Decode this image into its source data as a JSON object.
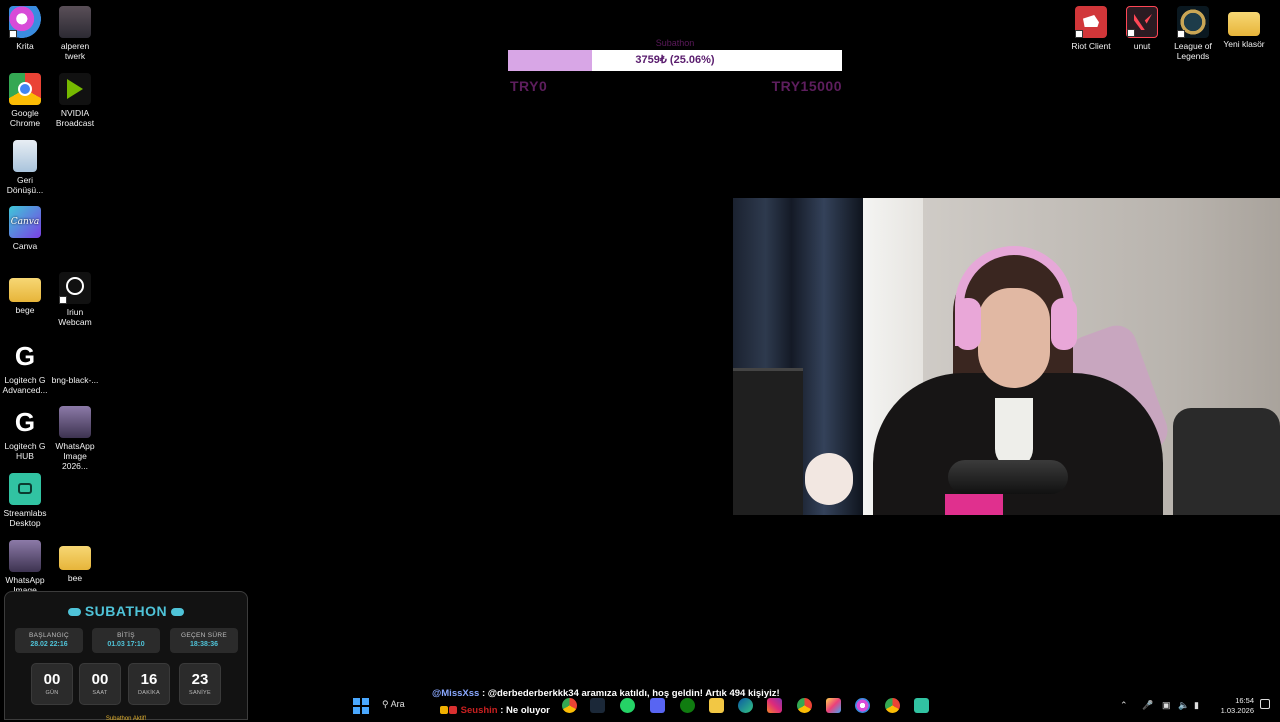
{
  "desktop_icons_left": [
    {
      "label": "Krita",
      "icon": "krita-icon"
    },
    {
      "label": "alperen twerk",
      "icon": "video-thumbnail-icon"
    },
    {
      "label": "Google Chrome",
      "icon": "chrome-icon"
    },
    {
      "label": "NVIDIA Broadcast",
      "icon": "nvidia-icon"
    },
    {
      "label": "Geri Dönüşü...",
      "icon": "recycle-bin-icon"
    },
    {
      "label": "Canva",
      "icon": "canva-icon"
    },
    {
      "label": "bege",
      "icon": "folder-icon"
    },
    {
      "label": "Iriun Webcam",
      "icon": "webcam-icon"
    },
    {
      "label": "Logitech G Advanced...",
      "icon": "logitech-icon"
    },
    {
      "label": "bng-black-...",
      "icon": "image-file-icon"
    },
    {
      "label": "Logitech G HUB",
      "icon": "logitech-icon"
    },
    {
      "label": "WhatsApp Image 2026...",
      "icon": "image-file-icon"
    },
    {
      "label": "Streamlabs Desktop",
      "icon": "streamlabs-icon"
    },
    {
      "label": "WhatsApp Image 2026...",
      "icon": "image-file-icon"
    },
    {
      "label": "bee",
      "icon": "folder-icon"
    }
  ],
  "desktop_icons_right": [
    {
      "label": "Riot Client",
      "icon": "riot-icon"
    },
    {
      "label": "unut",
      "icon": "valorant-icon"
    },
    {
      "label": "League of Legends",
      "icon": "league-icon"
    },
    {
      "label": "Yeni klasör",
      "icon": "folder-icon"
    }
  ],
  "goal": {
    "title": "Subathon",
    "progress_text": "3759₺ (25.06%)",
    "progress": 0.2506,
    "min_label": "TRY0",
    "max_label": "TRY15000",
    "fill_color": "#d8a6e6"
  },
  "subathon": {
    "title": "SUBATHON",
    "start_label": "BAŞLANGIÇ",
    "start_value": "28.02 22:16",
    "end_label": "BİTİŞ",
    "end_value": "01.03 17:10",
    "elapsed_label": "GEÇEN SÜRE",
    "elapsed_value": "18:38:36",
    "timer": [
      {
        "value": "00",
        "unit": "GÜN"
      },
      {
        "value": "00",
        "unit": "SAAT"
      },
      {
        "value": "16",
        "unit": "DAKİKA"
      },
      {
        "value": "23",
        "unit": "SANİYE"
      }
    ],
    "footer": "Subathon Aktif!",
    "accent_color": "#4fc3d8"
  },
  "chat": {
    "line1_user": "@MissXss",
    "line1_message": ": @derbederberkkk34 aramıza katıldı, hoş geldin! Artık 494 kişiyiz!",
    "line2_user": "Seushin",
    "line2_message": ": Ne oluyor"
  },
  "taskbar": {
    "search_label": "Ara",
    "apps": [
      "chrome-icon",
      "steam-icon",
      "whatsapp-icon",
      "discord-icon",
      "xbox-icon",
      "file-explorer-icon",
      "edge-icon",
      "instagram-icon",
      "chrome-icon",
      "photos-icon",
      "krita-icon",
      "chrome-icon",
      "streamlabs-icon"
    ],
    "time": "16:54",
    "date": "1.03.2026"
  }
}
